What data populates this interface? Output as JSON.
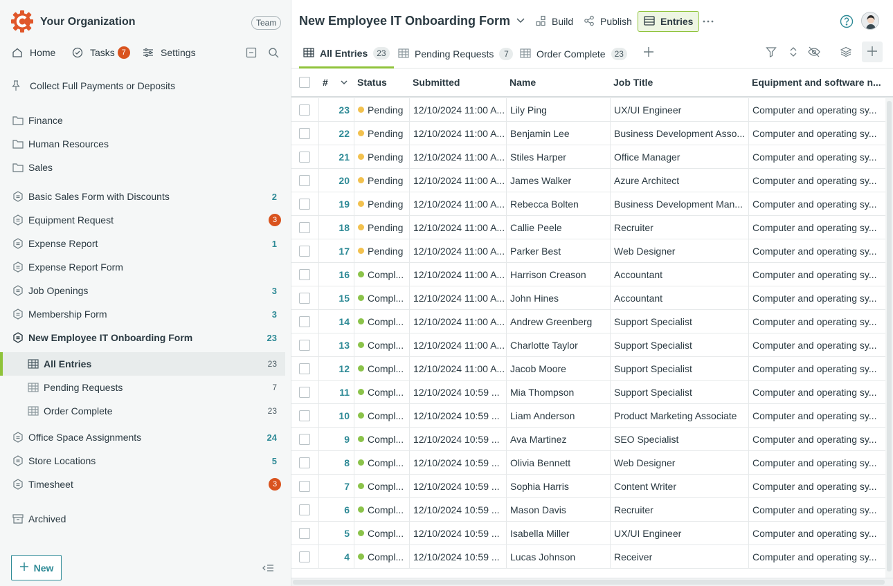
{
  "org": {
    "name": "Your Organization",
    "team_label": "Team"
  },
  "topnav": {
    "home": "Home",
    "tasks": "Tasks",
    "tasks_count": "7",
    "settings": "Settings"
  },
  "pinned": "Collect Full Payments or Deposits",
  "folders": [
    {
      "label": "Finance"
    },
    {
      "label": "Human Resources"
    },
    {
      "label": "Sales"
    }
  ],
  "forms": [
    {
      "label": "Basic Sales Form with Discounts",
      "count": "2",
      "badge": ""
    },
    {
      "label": "Equipment Request",
      "count": "",
      "badge": "3"
    },
    {
      "label": "Expense Report",
      "count": "1",
      "badge": ""
    },
    {
      "label": "Expense Report Form",
      "count": "",
      "badge": ""
    },
    {
      "label": "Job Openings",
      "count": "3",
      "badge": ""
    },
    {
      "label": "Membership Form",
      "count": "3",
      "badge": ""
    },
    {
      "label": "New Employee IT Onboarding Form",
      "count": "23",
      "badge": ""
    }
  ],
  "views": [
    {
      "label": "All Entries",
      "count": "23"
    },
    {
      "label": "Pending Requests",
      "count": "7"
    },
    {
      "label": "Order Complete",
      "count": "23"
    }
  ],
  "forms_after": [
    {
      "label": "Office Space Assignments",
      "count": "24",
      "badge": ""
    },
    {
      "label": "Store Locations",
      "count": "5",
      "badge": ""
    },
    {
      "label": "Timesheet",
      "count": "",
      "badge": "3"
    }
  ],
  "archived": "Archived",
  "new_button": "New",
  "header": {
    "title": "New Employee IT Onboarding Form",
    "build": "Build",
    "publish": "Publish",
    "entries": "Entries"
  },
  "tabs": [
    {
      "label": "All Entries",
      "count": "23"
    },
    {
      "label": "Pending Requests",
      "count": "7"
    },
    {
      "label": "Order Complete",
      "count": "23"
    }
  ],
  "columns": {
    "number": "#",
    "status": "Status",
    "submitted": "Submitted",
    "name": "Name",
    "job_title": "Job Title",
    "equipment": "Equipment and software n..."
  },
  "colors": {
    "accent": "#8fc33a",
    "teal": "#2e8a96",
    "pending": "#f2c14e",
    "complete": "#8bc34a",
    "badge": "#d9531e"
  },
  "rows": [
    {
      "id": "23",
      "status": "Pending",
      "submitted": "12/10/2024 11:00 A...",
      "name": "Lily Ping",
      "job": "UX/UI Engineer",
      "equip": "Computer and operating sy..."
    },
    {
      "id": "22",
      "status": "Pending",
      "submitted": "12/10/2024 11:00 A...",
      "name": "Benjamin Lee",
      "job": "Business Development Asso...",
      "equip": "Computer and operating sy..."
    },
    {
      "id": "21",
      "status": "Pending",
      "submitted": "12/10/2024 11:00 A...",
      "name": "Stiles Harper",
      "job": "Office Manager",
      "equip": "Computer and operating sy..."
    },
    {
      "id": "20",
      "status": "Pending",
      "submitted": "12/10/2024 11:00 A...",
      "name": "James Walker",
      "job": "Azure Architect",
      "equip": "Computer and operating sy..."
    },
    {
      "id": "19",
      "status": "Pending",
      "submitted": "12/10/2024 11:00 A...",
      "name": "Rebecca Bolten",
      "job": "Business Development Man...",
      "equip": "Computer and operating sy..."
    },
    {
      "id": "18",
      "status": "Pending",
      "submitted": "12/10/2024 11:00 A...",
      "name": "Callie Peele",
      "job": "Recruiter",
      "equip": "Computer and operating sy..."
    },
    {
      "id": "17",
      "status": "Pending",
      "submitted": "12/10/2024 11:00 A...",
      "name": "Parker Best",
      "job": "Web Designer",
      "equip": "Computer and operating sy..."
    },
    {
      "id": "16",
      "status": "Compl...",
      "submitted": "12/10/2024 11:00 A...",
      "name": "Harrison Creason",
      "job": "Accountant",
      "equip": "Computer and operating sy..."
    },
    {
      "id": "15",
      "status": "Compl...",
      "submitted": "12/10/2024 11:00 A...",
      "name": "John Hines",
      "job": "Accountant",
      "equip": "Computer and operating sy..."
    },
    {
      "id": "14",
      "status": "Compl...",
      "submitted": "12/10/2024 11:00 A...",
      "name": "Andrew Greenberg",
      "job": "Support Specialist",
      "equip": "Computer and operating sy..."
    },
    {
      "id": "13",
      "status": "Compl...",
      "submitted": "12/10/2024 11:00 A...",
      "name": "Charlotte Taylor",
      "job": "Support Specialist",
      "equip": "Computer and operating sy..."
    },
    {
      "id": "12",
      "status": "Compl...",
      "submitted": "12/10/2024 11:00 A...",
      "name": "Jacob Moore",
      "job": "Support Specialist",
      "equip": "Computer and operating sy..."
    },
    {
      "id": "11",
      "status": "Compl...",
      "submitted": "12/10/2024 10:59 ...",
      "name": "Mia Thompson",
      "job": "Support Specialist",
      "equip": "Computer and operating sy..."
    },
    {
      "id": "10",
      "status": "Compl...",
      "submitted": "12/10/2024 10:59 ...",
      "name": "Liam Anderson",
      "job": "Product Marketing Associate",
      "equip": "Computer and operating sy..."
    },
    {
      "id": "9",
      "status": "Compl...",
      "submitted": "12/10/2024 10:59 ...",
      "name": "Ava Martinez",
      "job": "SEO Specialist",
      "equip": "Computer and operating sy..."
    },
    {
      "id": "8",
      "status": "Compl...",
      "submitted": "12/10/2024 10:59 ...",
      "name": "Olivia Bennett",
      "job": "Web Designer",
      "equip": "Computer and operating sy..."
    },
    {
      "id": "7",
      "status": "Compl...",
      "submitted": "12/10/2024 10:59 ...",
      "name": "Sophia Harris",
      "job": "Content Writer",
      "equip": "Computer and operating sy..."
    },
    {
      "id": "6",
      "status": "Compl...",
      "submitted": "12/10/2024 10:59 ...",
      "name": "Mason Davis",
      "job": "Recruiter",
      "equip": "Computer and operating sy..."
    },
    {
      "id": "5",
      "status": "Compl...",
      "submitted": "12/10/2024 10:59 ...",
      "name": "Isabella Miller",
      "job": "UX/UI Engineer",
      "equip": "Computer and operating sy..."
    },
    {
      "id": "4",
      "status": "Compl...",
      "submitted": "12/10/2024 10:59 ...",
      "name": "Lucas Johnson",
      "job": "Receiver",
      "equip": "Computer and operating sy..."
    }
  ]
}
